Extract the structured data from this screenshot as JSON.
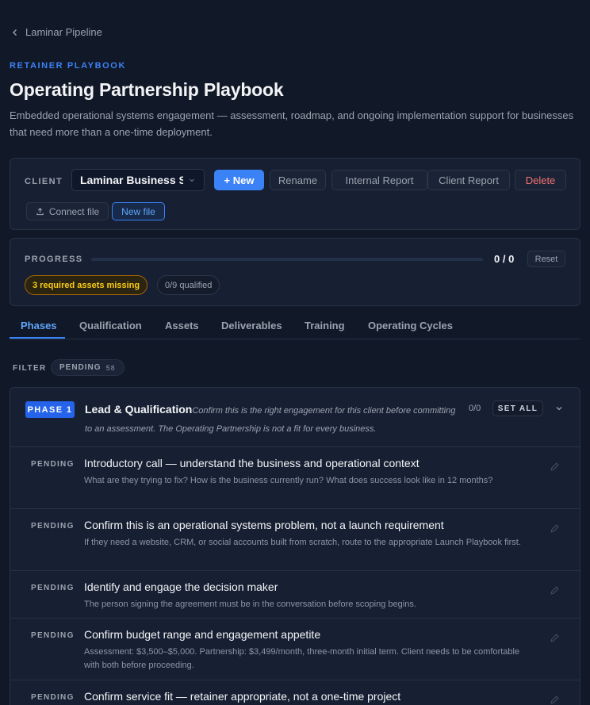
{
  "nav": {
    "back_label": "Laminar Pipeline"
  },
  "header": {
    "eyebrow": "RETAINER PLAYBOOK",
    "title": "Operating Partnership Playbook",
    "subtitle": "Embedded operational systems engagement — assessment, roadmap, and ongoing implementation support for businesses that need more than a one-time deployment."
  },
  "client": {
    "label": "CLIENT",
    "selected": "Laminar Business S",
    "buttons": {
      "new": "+ New",
      "rename": "Rename",
      "internal_report": "Internal Report",
      "client_report": "Client Report",
      "delete": "Delete",
      "connect_file": "Connect file",
      "new_file": "New file"
    }
  },
  "progress": {
    "label": "PROGRESS",
    "count": "0 / 0",
    "fraction": 0,
    "reset": "Reset",
    "missing_badge": "3 required assets missing",
    "qualified_badge": "0/9 qualified"
  },
  "tabs": [
    "Phases",
    "Qualification",
    "Assets",
    "Deliverables",
    "Training",
    "Operating Cycles"
  ],
  "active_tab": "Phases",
  "filter": {
    "label": "FILTER",
    "chip": "PENDING",
    "count": "58"
  },
  "phase": {
    "badge": "PHASE 1",
    "title": "Lead & Qualification",
    "description": "Confirm this is the right engagement for this client before committing to an assessment. The Operating Partnership is not a fit for every business.",
    "count": "0/0",
    "set_all": "SET ALL",
    "items": [
      {
        "status": "PENDING",
        "title": "Introductory call — understand the business and operational context",
        "desc": "What are they trying to fix? How is the business currently run? What does success look like in 12 months?"
      },
      {
        "status": "PENDING",
        "title": "Confirm this is an operational systems problem, not a launch requirement",
        "desc": "If they need a website, CRM, or social accounts built from scratch, route to the appropriate Launch Playbook first."
      },
      {
        "status": "PENDING",
        "title": "Identify and engage the decision maker",
        "desc": "The person signing the agreement must be in the conversation before scoping begins."
      },
      {
        "status": "PENDING",
        "title": "Confirm budget range and engagement appetite",
        "desc": "Assessment: $3,500–$5,000. Partnership: $3,499/month, three-month initial term. Client needs to be comfortable with both before proceeding."
      },
      {
        "status": "PENDING",
        "title": "Confirm service fit — retainer appropriate, not a one-time project",
        "desc": ""
      }
    ]
  },
  "colors": {
    "accent": "#3b82f6",
    "danger": "#f87171",
    "warning": "#facc15",
    "background": "#111827"
  }
}
